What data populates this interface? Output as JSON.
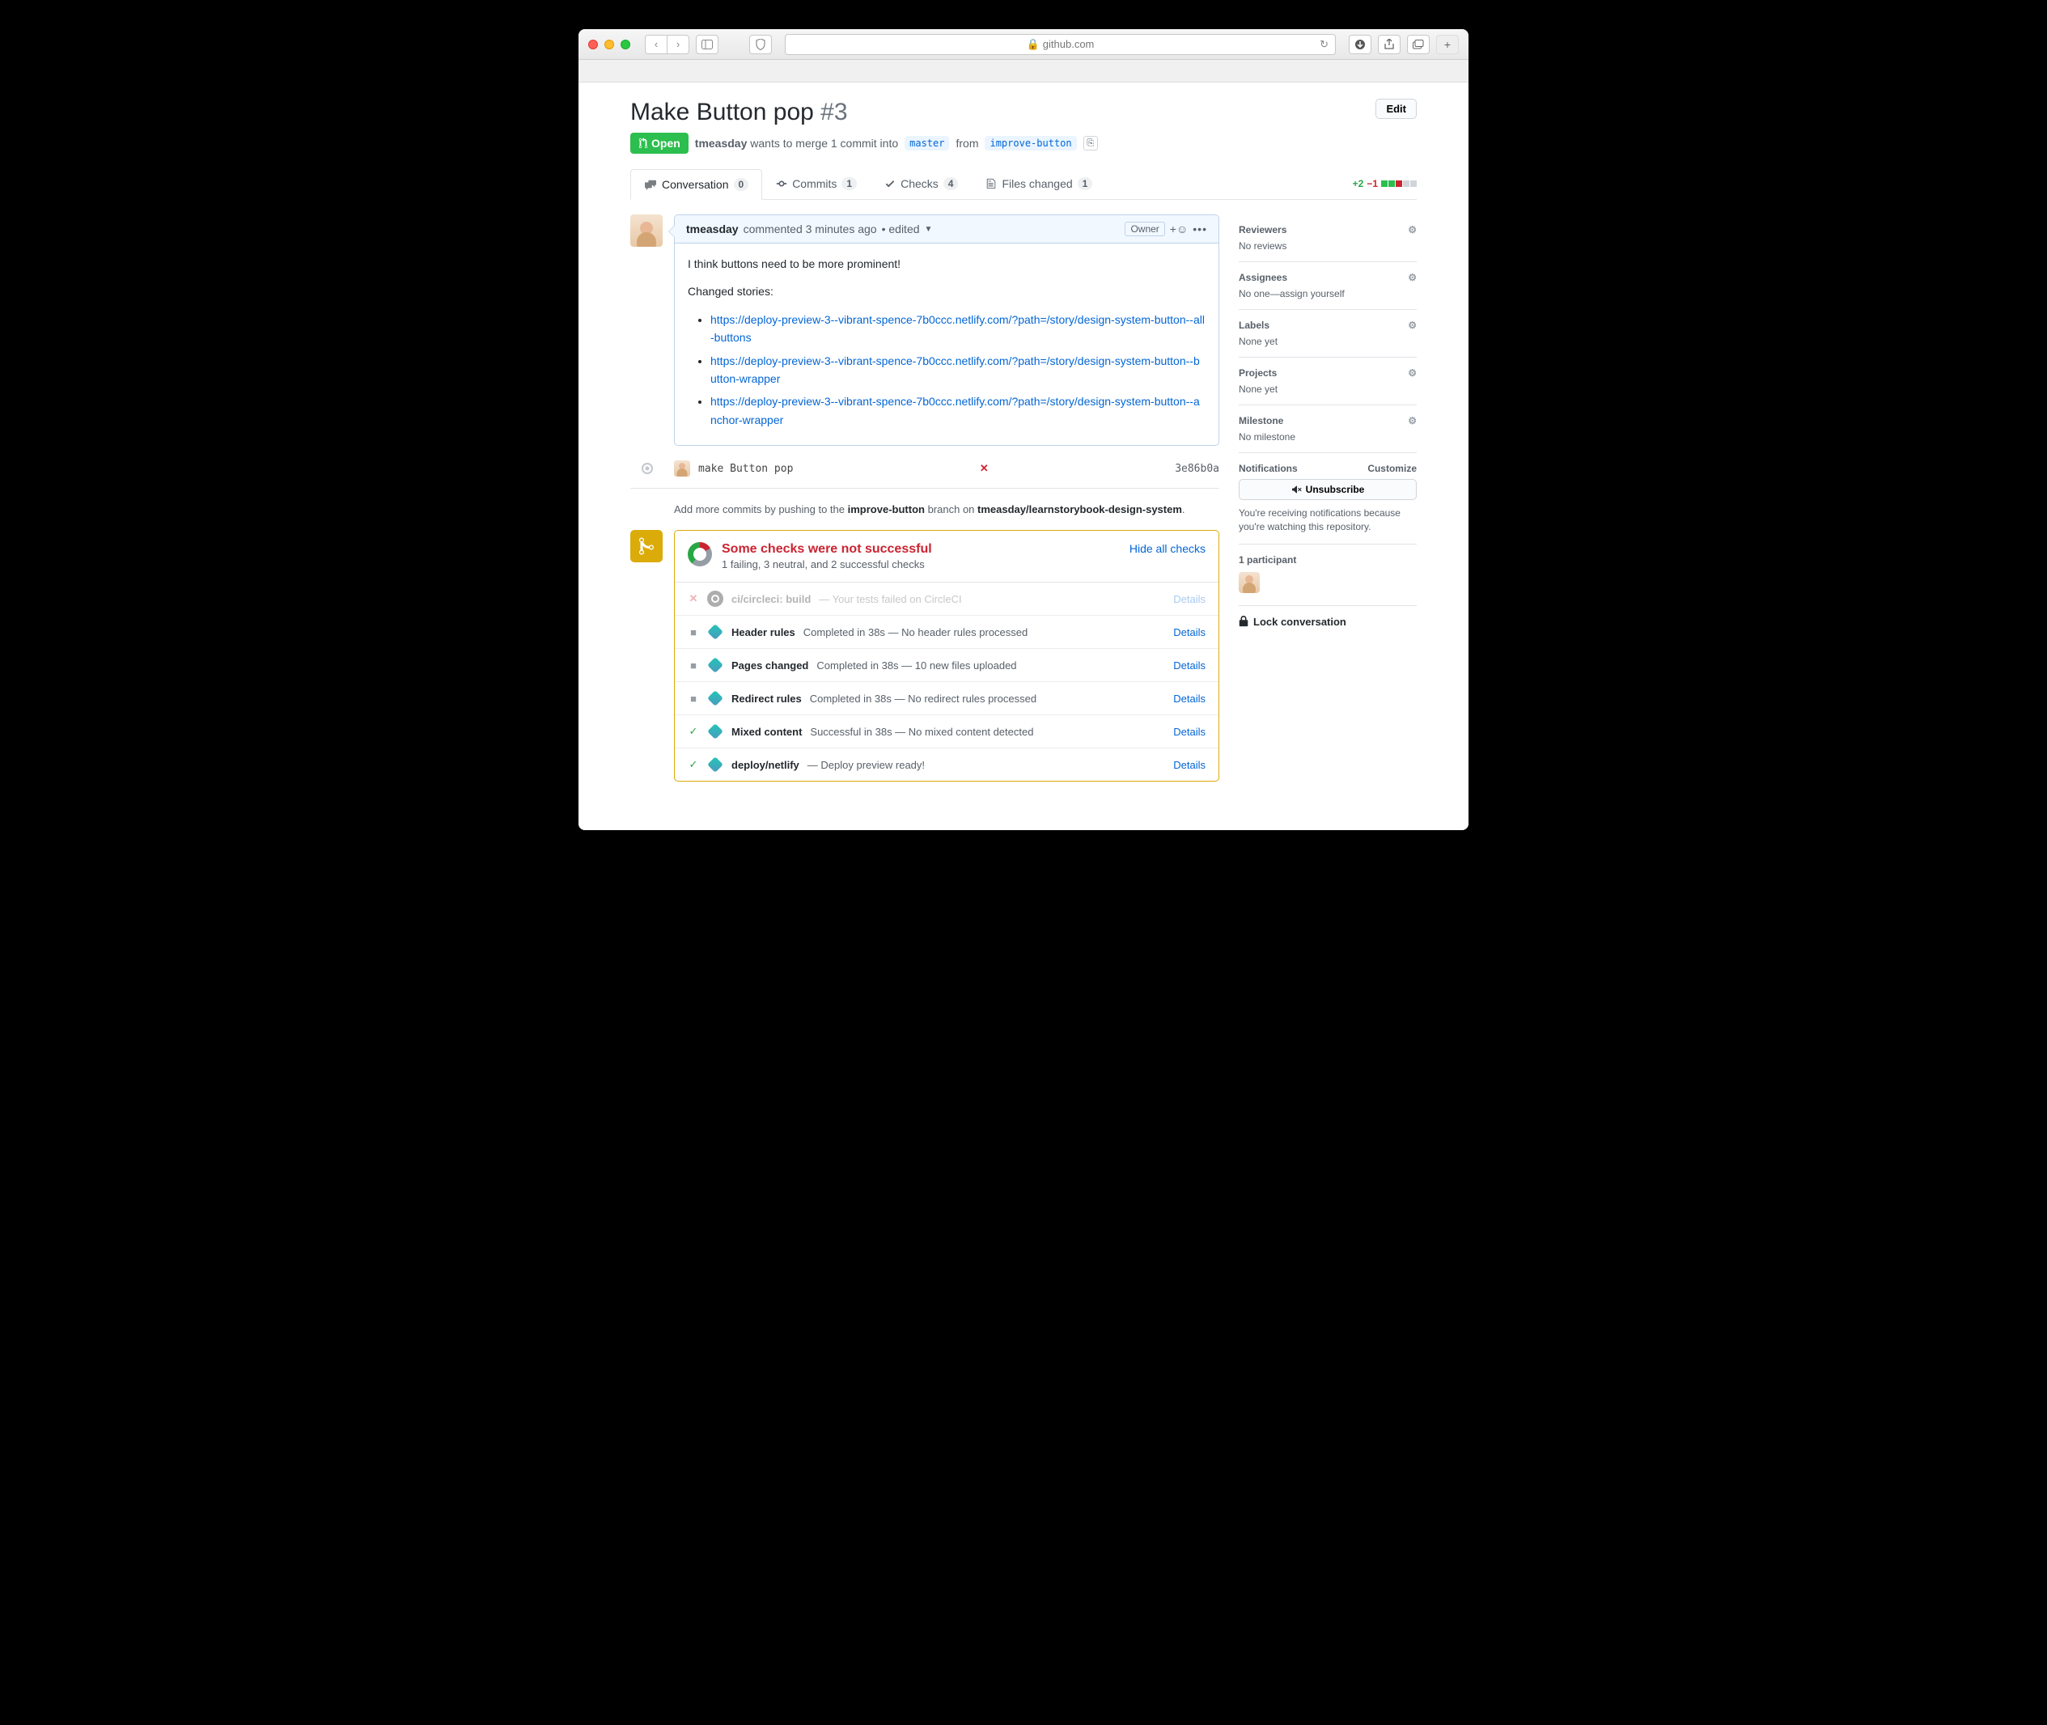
{
  "browser": {
    "domain": "github.com"
  },
  "pr": {
    "title": "Make Button pop",
    "number": "#3",
    "state": "Open",
    "author": "tmeasday",
    "merge_text_1": "wants to merge 1 commit into",
    "base_branch": "master",
    "merge_text_2": "from",
    "head_branch": "improve-button",
    "edit": "Edit"
  },
  "tabs": {
    "conversation": {
      "label": "Conversation",
      "count": "0"
    },
    "commits": {
      "label": "Commits",
      "count": "1"
    },
    "checks": {
      "label": "Checks",
      "count": "4"
    },
    "files": {
      "label": "Files changed",
      "count": "1"
    }
  },
  "diffstat": {
    "add": "+2",
    "del": "−1"
  },
  "comment": {
    "author": "tmeasday",
    "meta": "commented 3 minutes ago",
    "edited": "• edited",
    "owner": "Owner",
    "body_intro": "I think buttons need to be more prominent!",
    "body_changed": "Changed stories:",
    "links": [
      "https://deploy-preview-3--vibrant-spence-7b0ccc.netlify.com/?path=/story/design-system-button--all-buttons",
      "https://deploy-preview-3--vibrant-spence-7b0ccc.netlify.com/?path=/story/design-system-button--button-wrapper",
      "https://deploy-preview-3--vibrant-spence-7b0ccc.netlify.com/?path=/story/design-system-button--anchor-wrapper"
    ]
  },
  "commit": {
    "message": "make Button pop",
    "sha": "3e86b0a"
  },
  "push_hint": {
    "pre": "Add more commits by pushing to the",
    "branch": "improve-button",
    "mid": "branch on",
    "repo": "tmeasday/learnstorybook-design-system",
    "post": "."
  },
  "merge": {
    "title": "Some checks were not successful",
    "subtitle": "1 failing, 3 neutral, and 2 successful checks",
    "hide": "Hide all checks"
  },
  "checks": [
    {
      "status": "fail",
      "service": "circle",
      "name": "ci/circleci: build",
      "desc": "— Your tests failed on CircleCI",
      "details": "Details"
    },
    {
      "status": "neutral",
      "service": "netlify",
      "name": "Header rules",
      "desc": "Completed in 38s — No header rules processed",
      "details": "Details"
    },
    {
      "status": "neutral",
      "service": "netlify",
      "name": "Pages changed",
      "desc": "Completed in 38s — 10 new files uploaded",
      "details": "Details"
    },
    {
      "status": "neutral",
      "service": "netlify",
      "name": "Redirect rules",
      "desc": "Completed in 38s — No redirect rules processed",
      "details": "Details"
    },
    {
      "status": "pass",
      "service": "netlify",
      "name": "Mixed content",
      "desc": "Successful in 38s — No mixed content detected",
      "details": "Details"
    },
    {
      "status": "pass",
      "service": "netlify",
      "name": "deploy/netlify",
      "desc": "— Deploy preview ready!",
      "details": "Details"
    }
  ],
  "sidebar": {
    "reviewers": {
      "title": "Reviewers",
      "body": "No reviews"
    },
    "assignees": {
      "title": "Assignees",
      "body": "No one—assign yourself"
    },
    "labels": {
      "title": "Labels",
      "body": "None yet"
    },
    "projects": {
      "title": "Projects",
      "body": "None yet"
    },
    "milestone": {
      "title": "Milestone",
      "body": "No milestone"
    },
    "notifications": {
      "title": "Notifications",
      "customize": "Customize",
      "unsubscribe": "Unsubscribe",
      "text": "You're receiving notifications because you're watching this repository."
    },
    "participants": {
      "title": "1 participant"
    },
    "lock": "Lock conversation"
  }
}
